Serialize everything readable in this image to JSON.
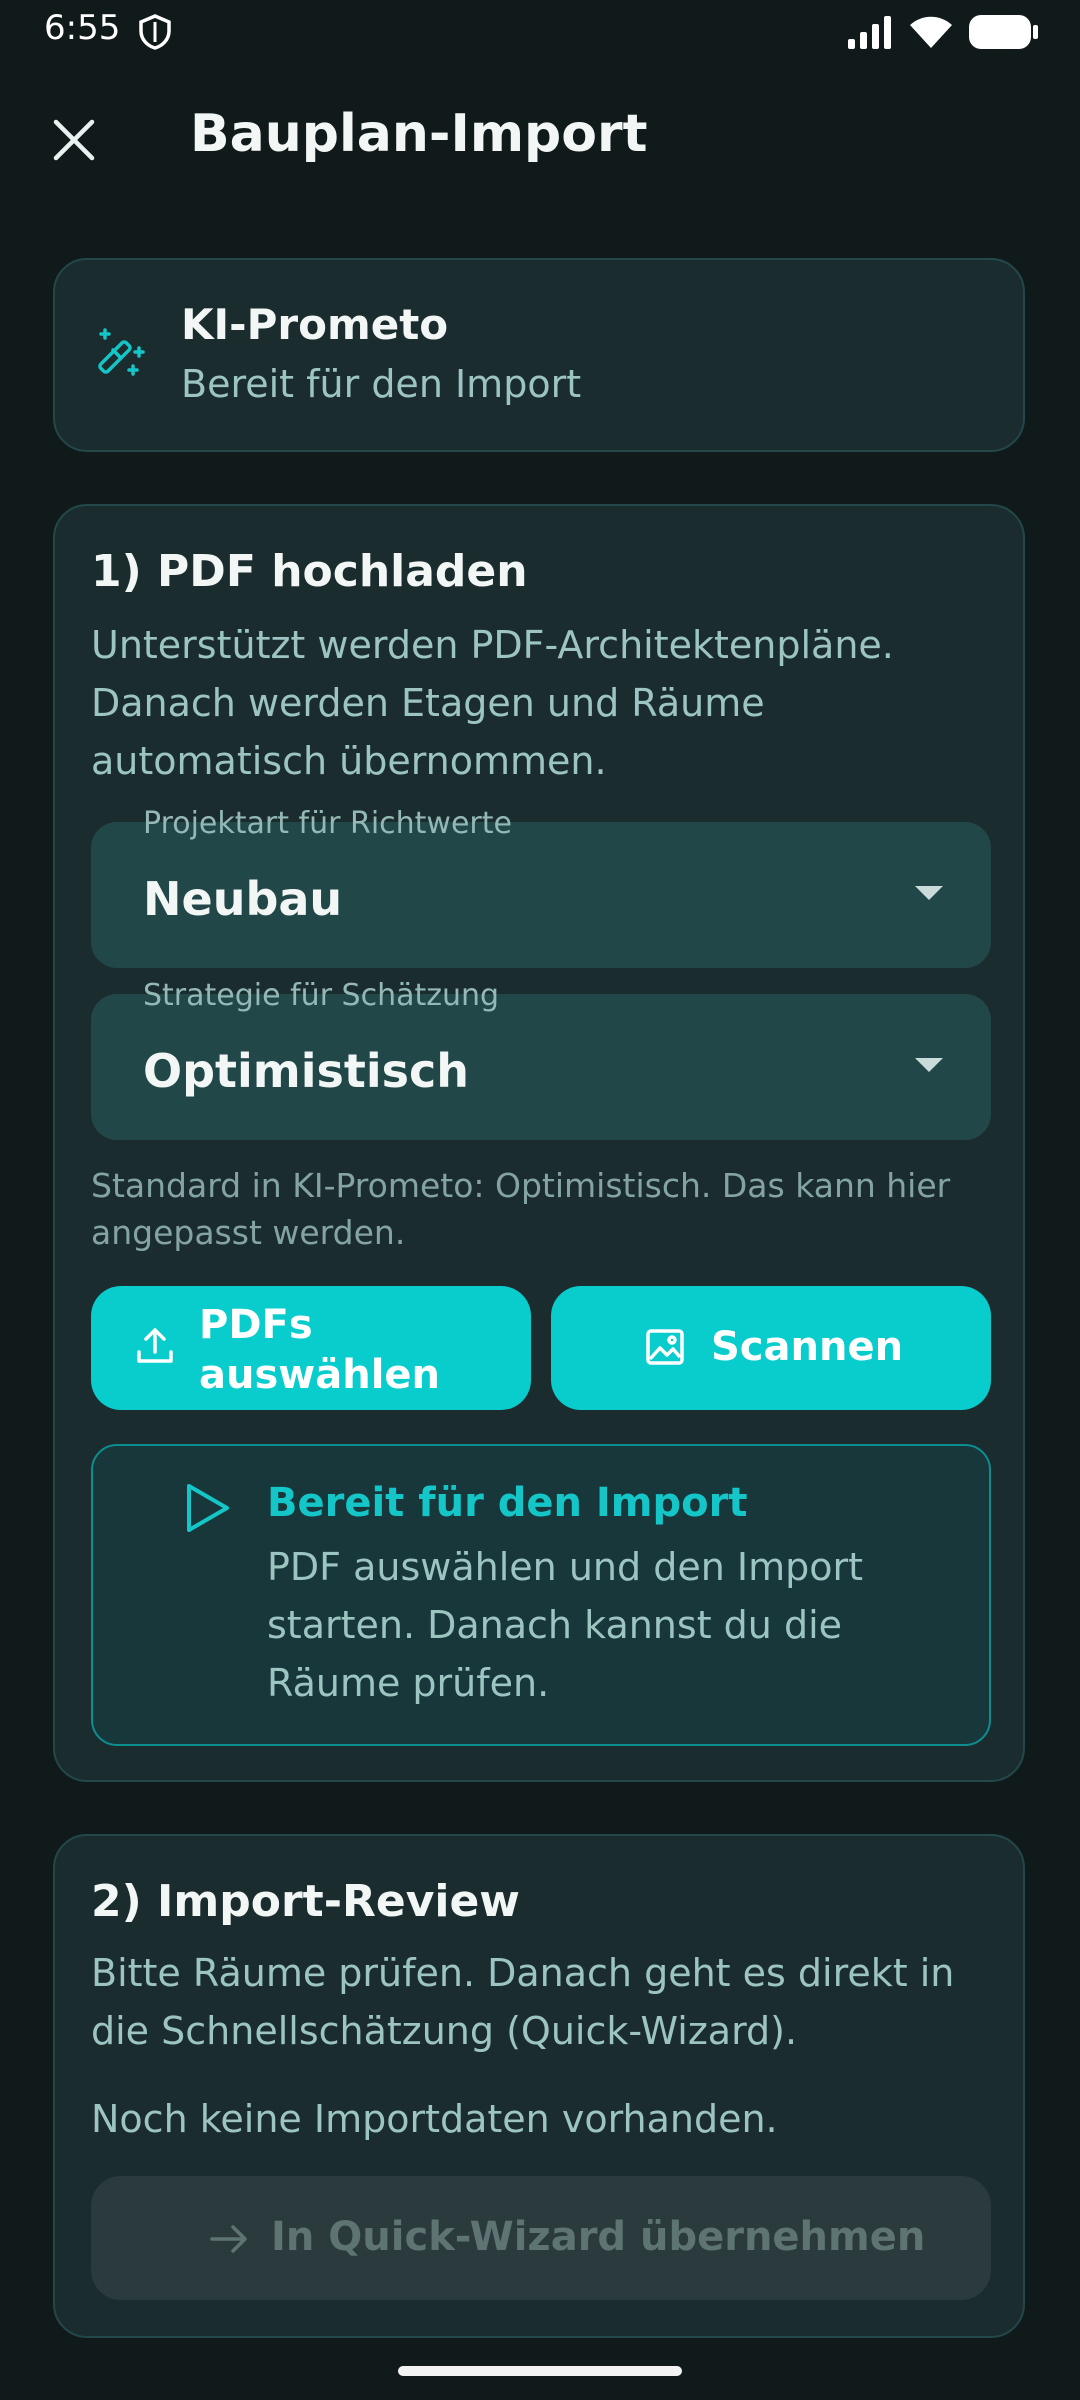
{
  "status": {
    "time": "6:55"
  },
  "appbar": {
    "title": "Bauplan-Import"
  },
  "hero": {
    "title": "KI-Prometo",
    "subtitle": "Bereit für den Import"
  },
  "upload": {
    "title": "1) PDF hochladen",
    "description": "Unterstützt werden PDF-Architektenpläne. Danach werden Etagen und Räume automatisch übernommen.",
    "project_type": {
      "label": "Projektart für Richtwerte",
      "value": "Neubau"
    },
    "strategy": {
      "label": "Strategie für Schätzung",
      "value": "Optimistisch"
    },
    "hint": "Standard in KI-Prometo: Optimistisch. Das kann hier angepasst werden.",
    "pdf_button": "PDFs auswählen",
    "scan_button": "Scannen",
    "info": {
      "title": "Bereit für den Import",
      "text": "PDF auswählen und den Import starten. Danach kannst du die Räume prüfen."
    }
  },
  "review": {
    "title": "2) Import-Review",
    "description": "Bitte Räume prüfen. Danach geht es direkt in die Schnellschätzung (Quick-Wizard).",
    "empty": "Noch keine Importdaten vorhanden.",
    "button": "In Quick-Wizard übernehmen"
  },
  "colors": {
    "accent": "#09cccd",
    "background": "#111a1b",
    "card": "#1b2c2f"
  }
}
